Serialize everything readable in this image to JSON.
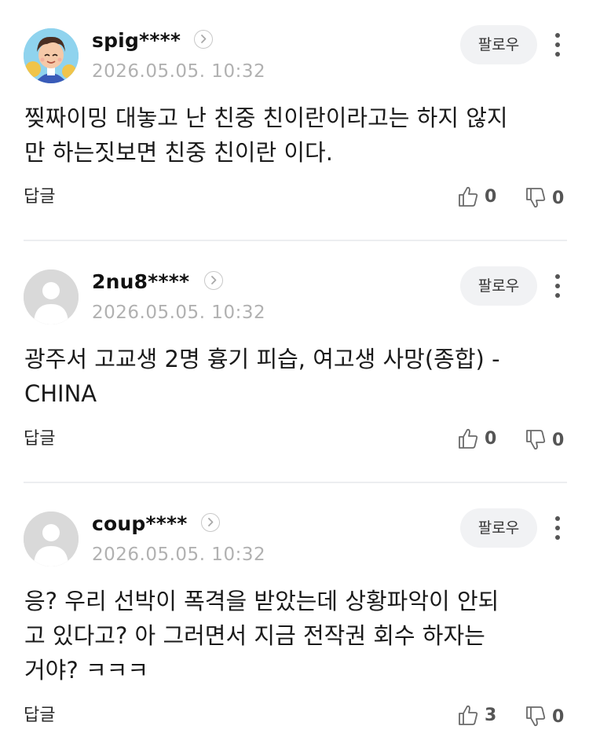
{
  "comments": [
    {
      "username": "spig****",
      "timestamp": "2026.05.05. 10:32",
      "follow_label": "팔로우",
      "text": "찢짜이밍 대놓고 난 친중 친이란이라고는 하지 않지\n만 하는짓보면 친중 친이란 이다.",
      "reply_label": "답글",
      "likes": "0",
      "dislikes": "0",
      "avatar": "custom-avatar"
    },
    {
      "username": "2nu8****",
      "timestamp": "2026.05.05. 10:32",
      "follow_label": "팔로우",
      "text": "광주서 고교생 2명 흉기 피습, 여고생 사망(종합) -\nCHINA",
      "reply_label": "답글",
      "likes": "0",
      "dislikes": "0",
      "avatar": "default-avatar"
    },
    {
      "username": "coup****",
      "timestamp": "2026.05.05. 10:32",
      "follow_label": "팔로우",
      "text": "응? 우리 선박이 폭격을 받았는데 상황파악이 안되\n고 있다고? 아 그러면서 지금 전작권 회수 하자는\n거야? ㅋㅋㅋ",
      "reply_label": "답글",
      "likes": "3",
      "dislikes": "0",
      "avatar": "default-avatar"
    }
  ],
  "icons": {
    "chevron": "chevron-right-icon",
    "more": "more-vertical-icon",
    "like": "thumbs-up-icon",
    "dislike": "thumbs-down-icon"
  },
  "colors": {
    "timestamp": "#b1b1b1",
    "follow_bg": "#f1f2f4",
    "divider": "#eceef0"
  }
}
